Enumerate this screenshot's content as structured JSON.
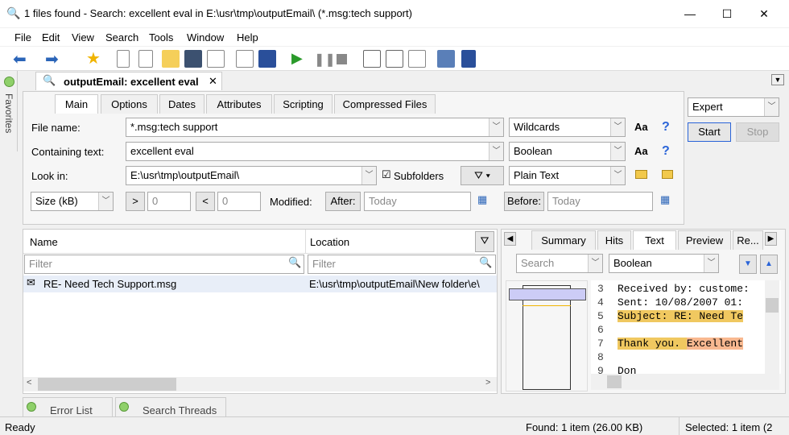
{
  "window": {
    "title": "1 files found - Search: excellent eval in E:\\usr\\tmp\\outputEmail\\ (*.msg:tech support)",
    "minimize": "—",
    "maximize": "☐",
    "close": "✕"
  },
  "menu": [
    "File",
    "Edit",
    "View",
    "Search",
    "Tools",
    "Window",
    "Help"
  ],
  "sidebar": {
    "favorites": "Favorites"
  },
  "doc_tab": {
    "label": "outputEmail: excellent eval",
    "close": "✕"
  },
  "tabs": [
    "Main",
    "Options",
    "Dates",
    "Attributes",
    "Scripting",
    "Compressed Files"
  ],
  "form": {
    "file_name_label": "File name:",
    "file_name": "*.msg:tech support",
    "file_mode": "Wildcards",
    "containing_label": "Containing text:",
    "containing": "excellent eval",
    "containing_mode": "Boolean",
    "look_in_label": "Look in:",
    "look_in": "E:\\usr\\tmp\\outputEmail\\",
    "subfolders": "Subfolders",
    "look_mode": "Plain Text",
    "size_unit": "Size (kB)",
    "gt": ">",
    "gt_value": "0",
    "lt": "<",
    "lt_value": "0",
    "modified_label": "Modified:",
    "after": "After:",
    "after_value": "Today",
    "before": "Before:",
    "before_value": "Today",
    "case_icon": "Aa",
    "help": "?"
  },
  "right_panel": {
    "mode": "Expert",
    "start": "Start",
    "stop": "Stop"
  },
  "results": {
    "col_name": "Name",
    "col_location": "Location",
    "filter_placeholder": "Filter",
    "rows": [
      {
        "name": "RE- Need Tech Support.msg",
        "location": "E:\\usr\\tmp\\outputEmail\\New folder\\e\\"
      }
    ]
  },
  "preview": {
    "tabs": [
      "Summary",
      "Hits",
      "Text",
      "Preview",
      "Re..."
    ],
    "search_placeholder": "Search",
    "mode": "Boolean",
    "lines": [
      {
        "n": "3",
        "t": "Received by: custome:"
      },
      {
        "n": "4",
        "t": "Sent: 10/08/2007 01:"
      },
      {
        "n": "5",
        "t": "Subject: RE: Need Te"
      },
      {
        "n": "6",
        "t": ""
      },
      {
        "n": "7",
        "t": "Thank you. ",
        "h": "Excellent"
      },
      {
        "n": "8",
        "t": ""
      },
      {
        "n": "9",
        "t": "Don"
      }
    ]
  },
  "bottom_tabs": [
    "Error List",
    "Search Threads"
  ],
  "status": {
    "left": "Ready",
    "found": "Found: 1 item (26.00 KB)",
    "selected": "Selected: 1 item (2"
  }
}
